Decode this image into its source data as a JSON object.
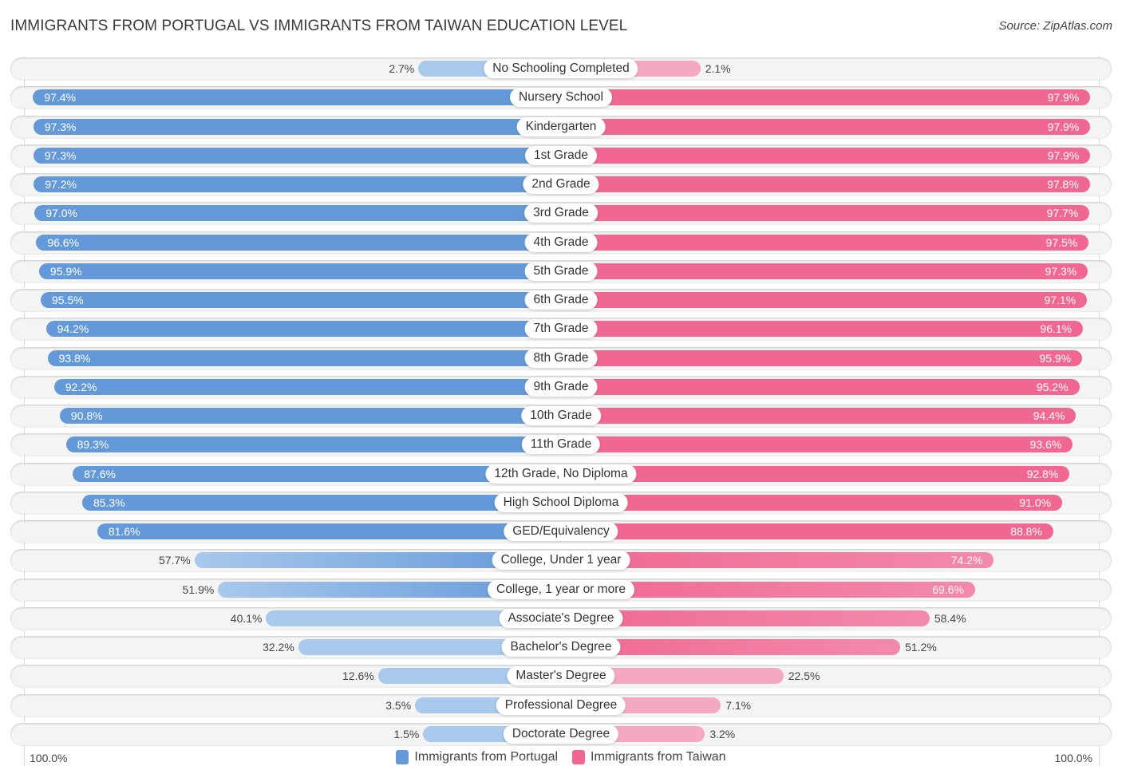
{
  "header": {
    "title": "IMMIGRANTS FROM PORTUGAL VS IMMIGRANTS FROM TAIWAN EDUCATION LEVEL",
    "source": "Source: ZipAtlas.com"
  },
  "colors": {
    "portugal": "#6399d9",
    "portugal_light": "#a8c8ec",
    "taiwan": "#f06892",
    "taiwan_light": "#f5a9c1"
  },
  "chart_data": {
    "type": "bar",
    "orientation": "horizontal-diverging",
    "title": "IMMIGRANTS FROM PORTUGAL VS IMMIGRANTS FROM TAIWAN EDUCATION LEVEL",
    "xlabel": "",
    "ylabel": "",
    "xlim": [
      0,
      100
    ],
    "axis_left_label": "100.0%",
    "axis_right_label": "100.0%",
    "legend_position": "bottom",
    "categories": [
      "No Schooling Completed",
      "Nursery School",
      "Kindergarten",
      "1st Grade",
      "2nd Grade",
      "3rd Grade",
      "4th Grade",
      "5th Grade",
      "6th Grade",
      "7th Grade",
      "8th Grade",
      "9th Grade",
      "10th Grade",
      "11th Grade",
      "12th Grade, No Diploma",
      "High School Diploma",
      "GED/Equivalency",
      "College, Under 1 year",
      "College, 1 year or more",
      "Associate's Degree",
      "Bachelor's Degree",
      "Master's Degree",
      "Professional Degree",
      "Doctorate Degree"
    ],
    "series": [
      {
        "name": "Immigrants from Portugal",
        "side": "left",
        "values": [
          2.7,
          97.4,
          97.3,
          97.3,
          97.2,
          97.0,
          96.6,
          95.9,
          95.5,
          94.2,
          93.8,
          92.2,
          90.8,
          89.3,
          87.6,
          85.3,
          81.6,
          57.7,
          51.9,
          40.1,
          32.2,
          12.6,
          3.5,
          1.5
        ],
        "labels": [
          "2.7%",
          "97.4%",
          "97.3%",
          "97.3%",
          "97.2%",
          "97.0%",
          "96.6%",
          "95.9%",
          "95.5%",
          "94.2%",
          "93.8%",
          "92.2%",
          "90.8%",
          "89.3%",
          "87.6%",
          "85.3%",
          "81.6%",
          "57.7%",
          "51.9%",
          "40.1%",
          "32.2%",
          "12.6%",
          "3.5%",
          "1.5%"
        ]
      },
      {
        "name": "Immigrants from Taiwan",
        "side": "right",
        "values": [
          2.1,
          97.9,
          97.9,
          97.9,
          97.8,
          97.7,
          97.5,
          97.3,
          97.1,
          96.1,
          95.9,
          95.2,
          94.4,
          93.6,
          92.8,
          91.0,
          88.8,
          74.2,
          69.6,
          58.4,
          51.2,
          22.5,
          7.1,
          3.2
        ],
        "labels": [
          "2.1%",
          "97.9%",
          "97.9%",
          "97.9%",
          "97.8%",
          "97.7%",
          "97.5%",
          "97.3%",
          "97.1%",
          "96.1%",
          "95.9%",
          "95.2%",
          "94.4%",
          "93.6%",
          "92.8%",
          "91.0%",
          "88.8%",
          "74.2%",
          "69.6%",
          "58.4%",
          "51.2%",
          "22.5%",
          "7.1%",
          "3.2%"
        ]
      }
    ]
  },
  "legend": {
    "items": [
      {
        "label": "Immigrants from Portugal"
      },
      {
        "label": "Immigrants from Taiwan"
      }
    ]
  }
}
